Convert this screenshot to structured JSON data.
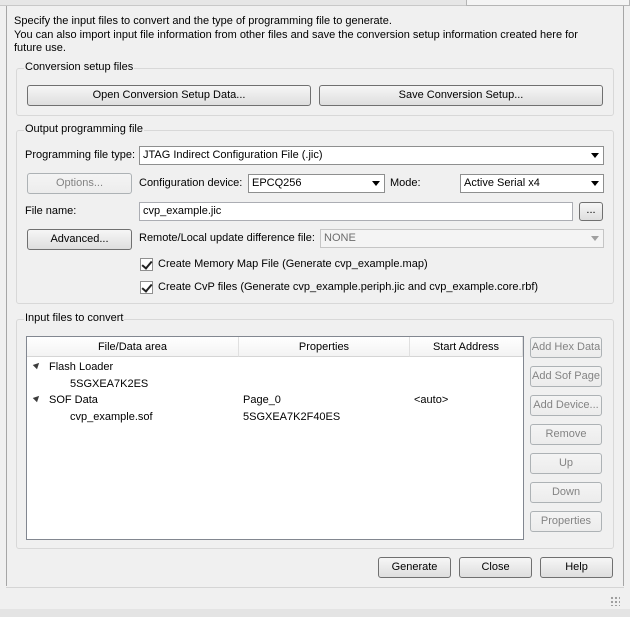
{
  "description": {
    "line1": "Specify the input files to convert and the type of programming file to generate.",
    "line2": "You can also import input file information from other files and save the conversion setup information created here for future use."
  },
  "conversion_setup": {
    "title": "Conversion setup files",
    "open_label": "Open Conversion Setup Data...",
    "save_label": "Save Conversion Setup..."
  },
  "output": {
    "title": "Output programming file",
    "file_type_label": "Programming file type:",
    "file_type_value": "JTAG Indirect Configuration File (.jic)",
    "options_label": "Options...",
    "config_device_label": "Configuration device:",
    "config_device_value": "EPCQ256",
    "mode_label": "Mode:",
    "mode_value": "Active Serial x4",
    "file_name_label": "File name:",
    "file_name_value": "cvp_example.jic",
    "browse_label": "...",
    "advanced_label": "Advanced...",
    "update_diff_label": "Remote/Local update difference file:",
    "update_diff_value": "NONE",
    "memory_map_label": "Create Memory Map File (Generate cvp_example.map)",
    "memory_map_checked": true,
    "cvp_label": "Create CvP files (Generate cvp_example.periph.jic and cvp_example.core.rbf)",
    "cvp_checked": true
  },
  "input_files": {
    "title": "Input files to convert",
    "columns": [
      "File/Data area",
      "Properties",
      "Start Address"
    ],
    "rows": [
      {
        "name": "Flash Loader",
        "properties": "",
        "address": ""
      },
      {
        "name": "5SGXEA7K2ES",
        "properties": "",
        "address": ""
      },
      {
        "name": "SOF Data",
        "properties": "Page_0",
        "address": "<auto>"
      },
      {
        "name": "cvp_example.sof",
        "properties": "5SGXEA7K2F40ES",
        "address": ""
      }
    ],
    "side_buttons": {
      "add_hex": "Add Hex Data",
      "add_sof": "Add Sof Page",
      "add_device": "Add Device...",
      "remove": "Remove",
      "up": "Up",
      "down": "Down",
      "properties": "Properties"
    }
  },
  "footer": {
    "generate": "Generate",
    "close": "Close",
    "help": "Help"
  }
}
